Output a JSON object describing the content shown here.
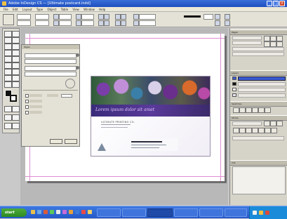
{
  "window": {
    "title": "Adobe InDesign CS — [Ultimate postcard.indd]"
  },
  "menu": [
    "File",
    "Edit",
    "Layout",
    "Type",
    "Object",
    "Table",
    "View",
    "Window",
    "Help"
  ],
  "dialog": {
    "title": "Pages",
    "fields": [
      "",
      "",
      "",
      ""
    ],
    "checks": [
      "",
      "",
      "",
      ""
    ]
  },
  "postcard": {
    "tagline": "Lorem ipsum dolor sit amet",
    "org": "ULTIMATE PRINTING CO."
  },
  "panels": {
    "top": "Pages",
    "layers": "Layers",
    "colors": "Swatches",
    "stroke": "Stroke",
    "info": "Info"
  },
  "taskbar": {
    "start_label": "start",
    "clock": ""
  },
  "colors": {
    "accent": "#3a5ad0",
    "taskbar": "#2458c8",
    "start": "#2d8a22"
  }
}
